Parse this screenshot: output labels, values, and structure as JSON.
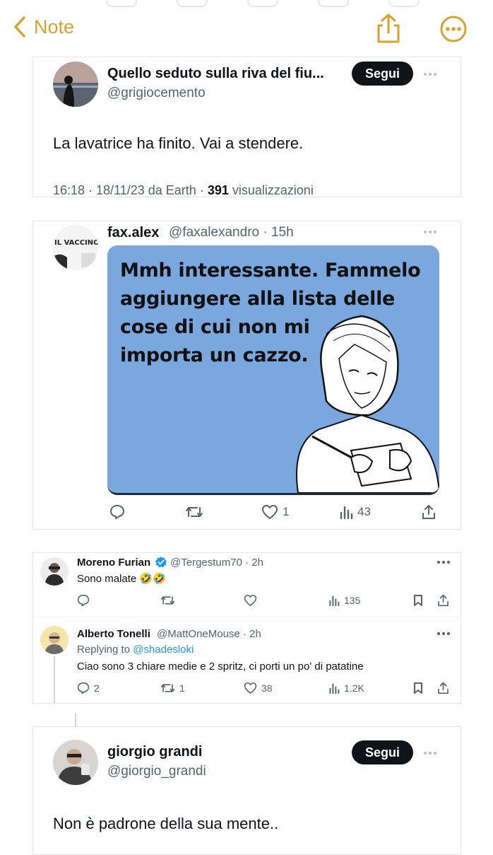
{
  "nav": {
    "back_label": "Note",
    "accent": "#d9a22d"
  },
  "tweet1": {
    "name": "Quello seduto sulla riva del fiu...",
    "handle": "@grigiocemento",
    "follow_label": "Segui",
    "text": "La lavatrice ha finito. Vai a stendere.",
    "meta_prefix": "16:18 · 18/11/23 da Earth · ",
    "views_count": "391",
    "views_label": " visualizzazioni"
  },
  "tweet2": {
    "name": "fax.alex",
    "handle_time": "@faxalexandro · 15h",
    "avatar_text": "IL VACCINO",
    "meme_lines": [
      "Mmh interessante. Fammelo",
      "aggiungere alla lista delle",
      "cose di cui non mi",
      "importa un cazzo."
    ],
    "actions": {
      "likes": "1",
      "views": "43"
    }
  },
  "reply1": {
    "name": "Moreno Furian",
    "handle_time": "@Tergestum70 · 2h",
    "text": "Sono malate 🤣🤣",
    "actions": {
      "views": "135"
    }
  },
  "reply2": {
    "name": "Alberto Tonelli",
    "handle_time": "@MattOneMouse · 2h",
    "replying_prefix": "Replying to ",
    "replying_handle": "@shadesloki",
    "text": "Ciao sono 3 chiare medie e 2 spritz, ci porti un po' di patatine",
    "actions": {
      "replies": "2",
      "retweets": "1",
      "likes": "38",
      "views": "1.2K"
    }
  },
  "tweet3": {
    "name": "giorgio grandi",
    "handle": "@giorgio_grandi",
    "follow_label": "Segui",
    "text": "Non è padrone della sua mente.."
  },
  "icons": [
    "chevron-left-icon",
    "share-icon",
    "more-circle-icon",
    "reply-icon",
    "retweet-icon",
    "heart-icon",
    "views-icon",
    "bookmark-icon",
    "verified-icon"
  ]
}
